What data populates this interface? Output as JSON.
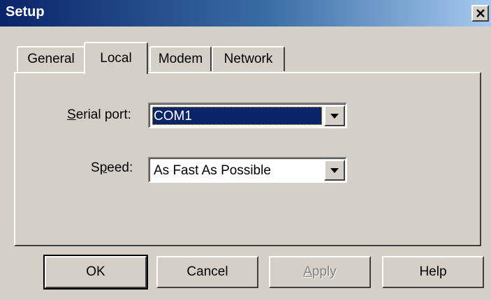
{
  "window": {
    "title": "Setup",
    "close_icon": "close-icon"
  },
  "tabs": [
    {
      "label": "General",
      "active": false
    },
    {
      "label": "Local",
      "active": true
    },
    {
      "label": "Modem",
      "active": false
    },
    {
      "label": "Network",
      "active": false
    }
  ],
  "local": {
    "serial_port": {
      "label_pre": "",
      "label_mnemonic": "S",
      "label_post": "erial port:",
      "value": "COM1"
    },
    "speed": {
      "label_pre": "S",
      "label_mnemonic": "p",
      "label_post": "eed:",
      "value": "As Fast As Possible"
    }
  },
  "buttons": {
    "ok": "OK",
    "cancel": "Cancel",
    "apply_mnemonic": "A",
    "apply_rest": "pply",
    "help": "Help"
  },
  "colors": {
    "face": "#d4d0c8",
    "title_start": "#0a246a",
    "title_end": "#a6caf0",
    "selection": "#0a246a"
  }
}
